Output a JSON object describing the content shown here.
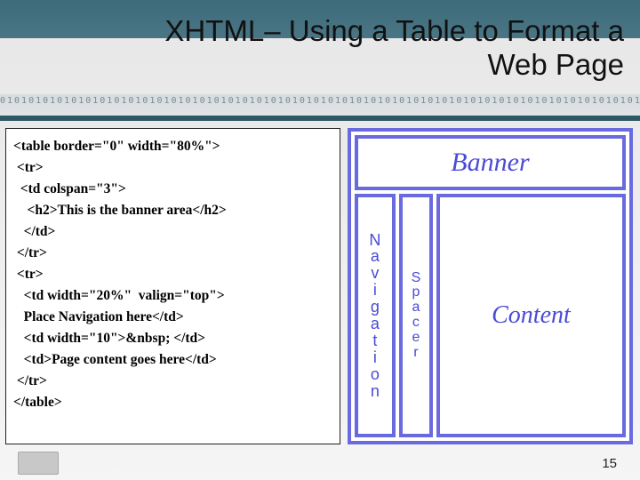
{
  "title": "XHTML– Using a Table to Format a Web Page",
  "binary_bg": "01010101010101010101010101010101010101010101010101010101010101010101010101010101010101010101010101010101010101010101010101010101",
  "code": {
    "l01": "<table border=\"0\" width=\"80%\">",
    "l02": " <tr>",
    "l03": "  <td colspan=\"3\">",
    "l04": "    <h2>This is the banner area</h2>",
    "l05": "   </td>",
    "l06": " </tr>",
    "l07": " <tr>",
    "l08": "   <td width=\"20%\"  valign=\"top\">",
    "l09": "   Place Navigation here</td>",
    "l10": "   <td width=\"10\">&nbsp; </td>",
    "l11": "   <td>Page content goes here</td>",
    "l12": " </tr>",
    "l13": "</table>"
  },
  "diagram": {
    "banner": "Banner",
    "nav": "Navigation",
    "spacer": "Spacer",
    "content": "Content"
  },
  "page_number": "15"
}
